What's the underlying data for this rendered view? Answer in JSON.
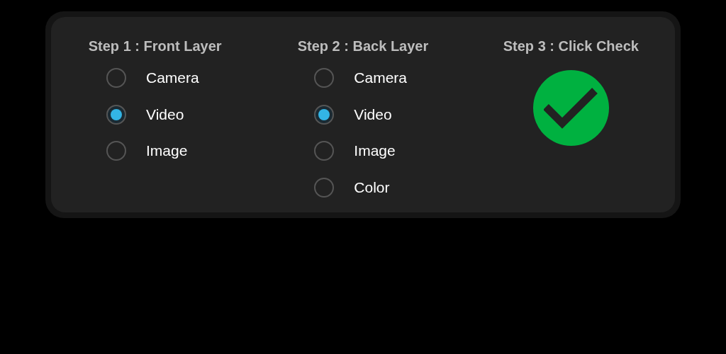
{
  "steps": [
    {
      "kind": "radio",
      "title": "Step 1 : Front Layer",
      "options": [
        {
          "label": "Camera",
          "selected": false
        },
        {
          "label": "Video",
          "selected": true
        },
        {
          "label": "Image",
          "selected": false
        }
      ]
    },
    {
      "kind": "radio",
      "title": "Step 2 : Back Layer",
      "options": [
        {
          "label": "Camera",
          "selected": false
        },
        {
          "label": "Video",
          "selected": true
        },
        {
          "label": "Image",
          "selected": false
        },
        {
          "label": "Color",
          "selected": false
        }
      ]
    },
    {
      "kind": "check",
      "title": "Step 3 : Click Check"
    }
  ]
}
